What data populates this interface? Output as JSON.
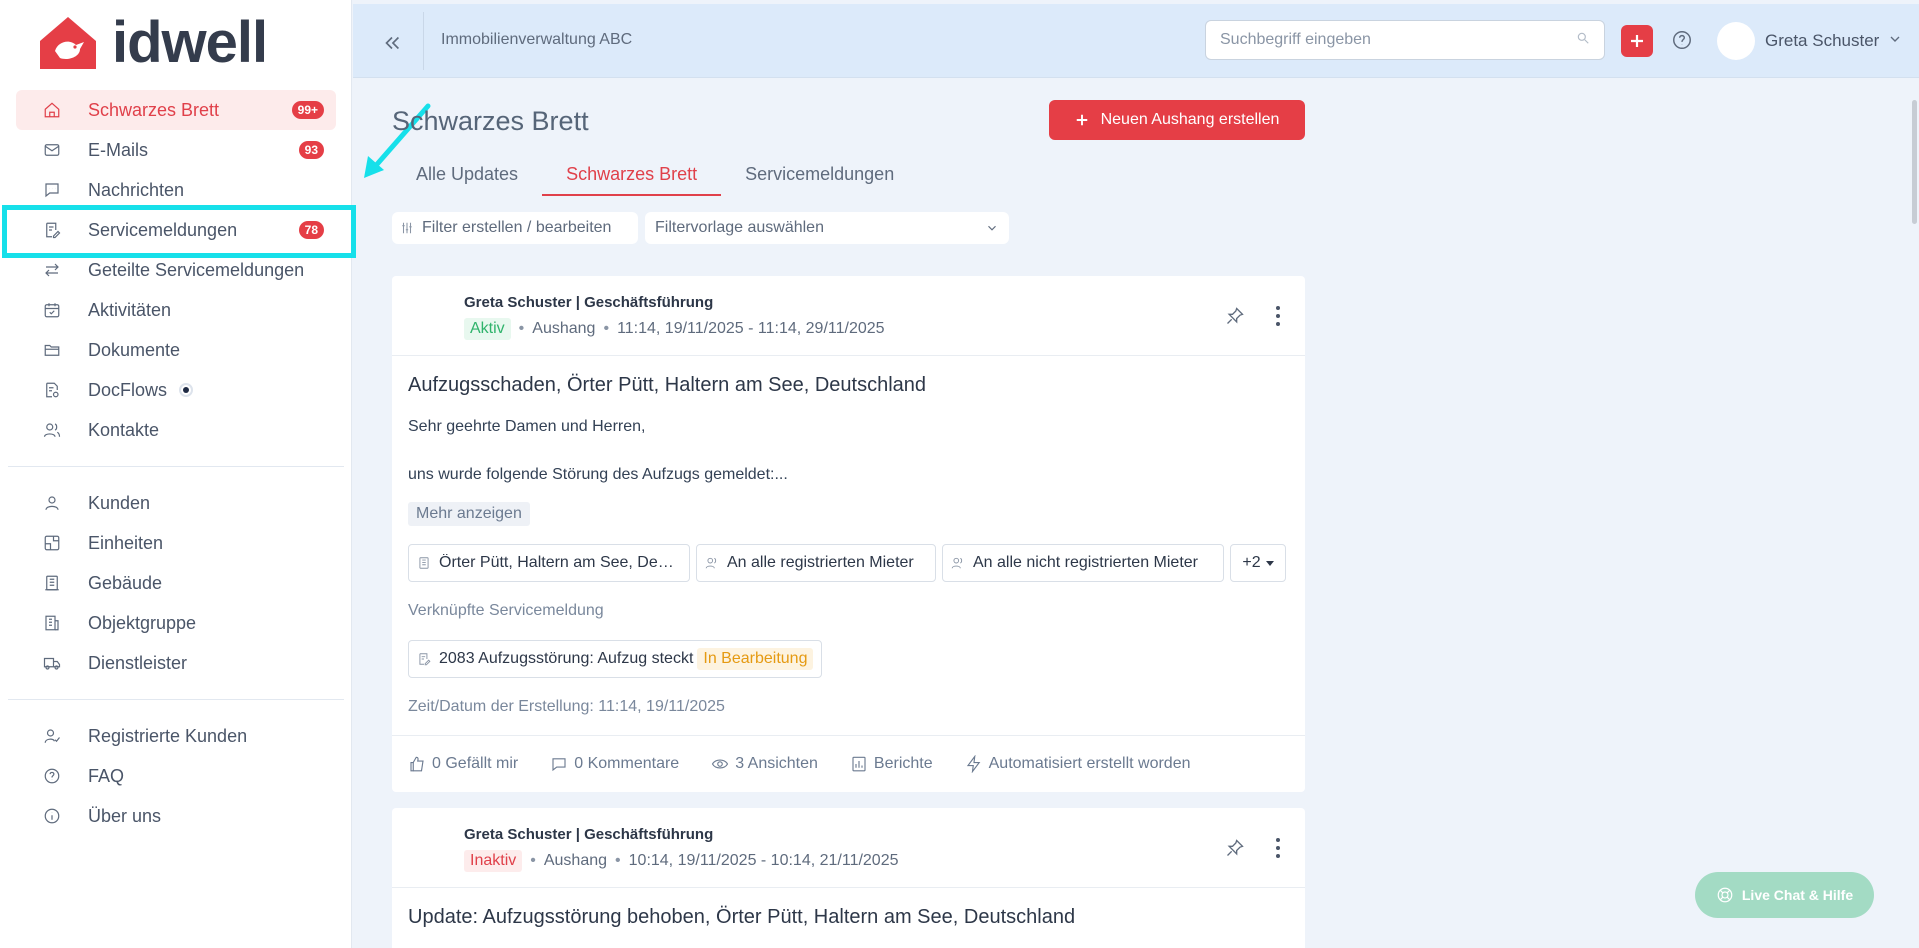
{
  "brand": {
    "name": "idwell",
    "accent": "#e53e46",
    "highlight": "#16e0ea"
  },
  "sidebar": {
    "items": [
      {
        "label": "Schwarzes Brett",
        "icon": "home-icon",
        "badge": "99+",
        "active": true
      },
      {
        "label": "E-Mails",
        "icon": "mail-icon",
        "badge": "93"
      },
      {
        "label": "Nachrichten",
        "icon": "message-icon"
      },
      {
        "label": "Servicemeldungen",
        "icon": "service-report-icon",
        "badge": "78"
      },
      {
        "label": "Geteilte Servicemeldungen",
        "icon": "share-arrows-icon"
      },
      {
        "label": "Aktivitäten",
        "icon": "calendar-check-icon"
      },
      {
        "label": "Dokumente",
        "icon": "folder-icon"
      },
      {
        "label": "DocFlows",
        "icon": "docflow-icon"
      },
      {
        "label": "Kontakte",
        "icon": "contacts-icon"
      }
    ],
    "group2": [
      {
        "label": "Kunden",
        "icon": "user-icon"
      },
      {
        "label": "Einheiten",
        "icon": "unit-icon"
      },
      {
        "label": "Gebäude",
        "icon": "building-icon"
      },
      {
        "label": "Objektgruppe",
        "icon": "office-building-icon"
      },
      {
        "label": "Dienstleister",
        "icon": "truck-icon"
      }
    ],
    "group3": [
      {
        "label": "Registrierte Kunden",
        "icon": "user-check-icon"
      },
      {
        "label": "FAQ",
        "icon": "question-circle-icon"
      },
      {
        "label": "Über uns",
        "icon": "info-circle-icon"
      }
    ]
  },
  "header": {
    "org_name": "Immobilienverwaltung ABC",
    "search_placeholder": "Suchbegriff eingeben",
    "user_name": "Greta Schuster"
  },
  "main": {
    "title": "Schwarzes Brett",
    "create_label": "Neuen Aushang erstellen",
    "tabs": [
      {
        "label": "Alle Updates"
      },
      {
        "label": "Schwarzes Brett",
        "active": true
      },
      {
        "label": "Servicemeldungen"
      }
    ],
    "filter_label": "Filter erstellen / bearbeiten",
    "filter_template_placeholder": "Filtervorlage auswählen"
  },
  "posts": [
    {
      "author": "Greta Schuster | Geschäftsführung",
      "status": "Aktiv",
      "type": "Aushang",
      "time_range": "11:14, 19/11/2025 - 11:14, 29/11/2025",
      "title": "Aufzugsschaden, Örter Pütt, Haltern am See, Deutschland",
      "body_line1": "Sehr geehrte Damen und Herren,",
      "body_line2": "uns wurde folgende Störung des Aufzugs gemeldet:...",
      "more_label": "Mehr anzeigen",
      "chips": [
        "Örter Pütt, Haltern am See, Deutschland",
        "An alle registrierten Mieter",
        "An alle nicht registrierten Mieter",
        "+2"
      ],
      "linked_label": "Verknüpfte Servicemeldung",
      "linked_text": "2083 Aufzugsstörung: Aufzug steckt",
      "linked_status": "In Bearbeitung",
      "created": "Zeit/Datum der Erstellung: 11:14, 19/11/2025",
      "footer": {
        "likes": "0 Gefällt mir",
        "comments": "0 Kommentare",
        "views": "3 Ansichten",
        "reports": "Berichte",
        "auto": "Automatisiert erstellt worden"
      }
    },
    {
      "author": "Greta Schuster | Geschäftsführung",
      "status": "Inaktiv",
      "type": "Aushang",
      "time_range": "10:14, 19/11/2025 - 10:14, 21/11/2025",
      "title": "Update: Aufzugsstörung behoben, Örter Pütt, Haltern am See, Deutschland"
    }
  ],
  "chat": {
    "label": "Live Chat & Hilfe"
  }
}
